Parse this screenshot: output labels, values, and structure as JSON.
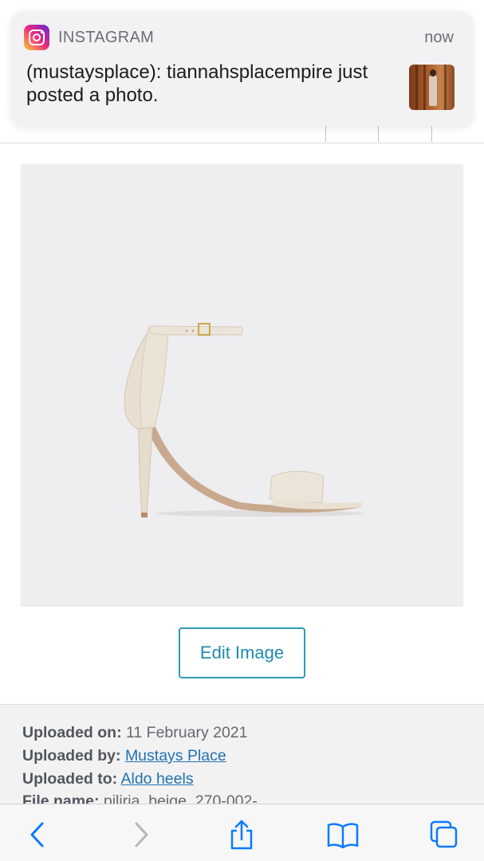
{
  "notification": {
    "app_name": "INSTAGRAM",
    "time": "now",
    "message": "(mustaysplace): tiannahsplacempire just posted a photo.",
    "app_icon": "instagram-icon",
    "thumbnail": "post-thumbnail"
  },
  "media": {
    "image_subject": "beige-heeled-sandal",
    "edit_button_label": "Edit Image"
  },
  "details": {
    "uploaded_on_label": "Uploaded on:",
    "uploaded_on_value": "11 February 2021",
    "uploaded_by_label": "Uploaded by:",
    "uploaded_by_value": "Mustays Place",
    "uploaded_to_label": "Uploaded to:",
    "uploaded_to_value": "Aldo heels",
    "file_name_label": "File name:",
    "file_name_value": "piliria_beige_270-002-"
  },
  "toolbar": {
    "back_icon": "chevron-left-icon",
    "forward_icon": "chevron-right-icon",
    "share_icon": "share-icon",
    "bookmarks_icon": "book-icon",
    "tabs_icon": "tabs-icon"
  },
  "colors": {
    "accent": "#2271b1",
    "button_border": "#2f9bb5",
    "ios_blue": "#0a7aff",
    "image_bg": "#eeedf0"
  }
}
